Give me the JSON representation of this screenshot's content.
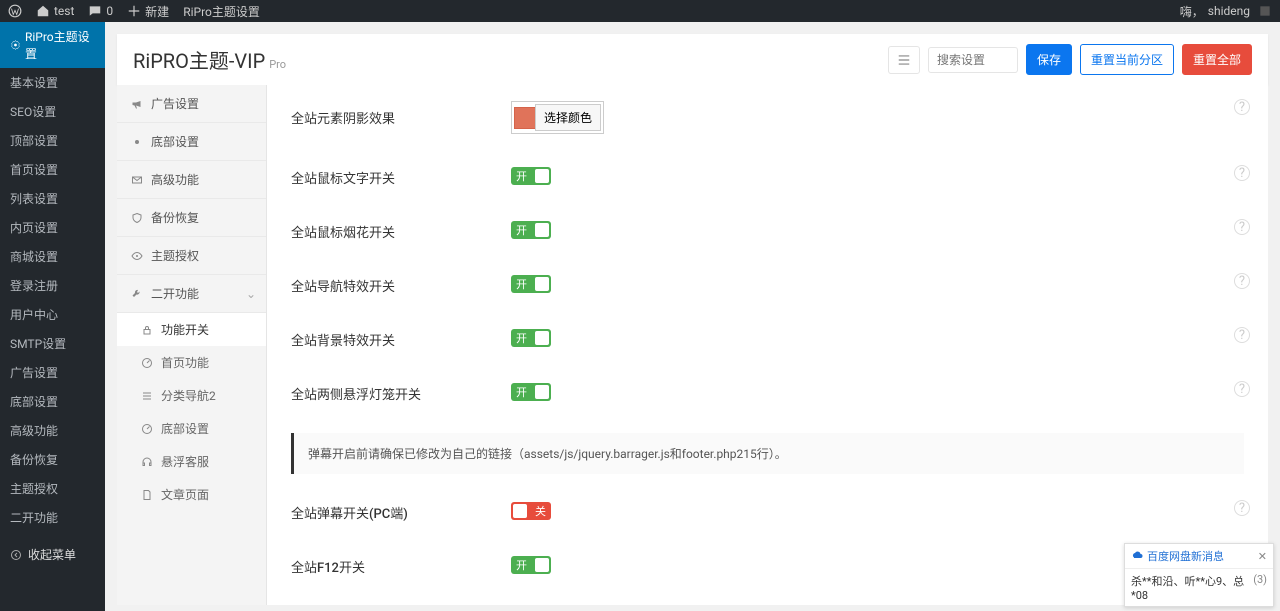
{
  "adminbar": {
    "site_name": "test",
    "comments_count": "0",
    "new_label": "新建",
    "theme_settings": "RiPro主题设置",
    "greeting": "嗨，",
    "user": "shideng"
  },
  "wp_menu": {
    "current": "RiPro主题设置",
    "items": [
      "基本设置",
      "SEO设置",
      "顶部设置",
      "首页设置",
      "列表设置",
      "内页设置",
      "商城设置",
      "登录注册",
      "用户中心",
      "SMTP设置",
      "广告设置",
      "底部设置",
      "高级功能",
      "备份恢复",
      "主题授权",
      "二开功能"
    ],
    "collapse": "收起菜单"
  },
  "header": {
    "title": "RiPRO主题-VIP",
    "badge": "Pro",
    "search_placeholder": "搜索设置",
    "save": "保存",
    "reset_section": "重置当前分区",
    "reset_all": "重置全部"
  },
  "panel_nav": {
    "items": [
      {
        "icon": "bullhorn",
        "label": "广告设置"
      },
      {
        "icon": "dot",
        "label": "底部设置"
      },
      {
        "icon": "envelope",
        "label": "高级功能"
      },
      {
        "icon": "shield",
        "label": "备份恢复"
      },
      {
        "icon": "eye",
        "label": "主题授权"
      },
      {
        "icon": "wrench",
        "label": "二开功能",
        "expanded": true
      }
    ],
    "subs": [
      {
        "icon": "lock",
        "label": "功能开关",
        "active": true
      },
      {
        "icon": "dashboard",
        "label": "首页功能"
      },
      {
        "icon": "list",
        "label": "分类导航2"
      },
      {
        "icon": "dashboard",
        "label": "底部设置"
      },
      {
        "icon": "headset",
        "label": "悬浮客服"
      },
      {
        "icon": "page",
        "label": "文章页面"
      }
    ]
  },
  "settings": [
    {
      "key": "shadow",
      "label": "全站元素阴影效果",
      "type": "color",
      "color": "#e0735a",
      "btn": "选择颜色"
    },
    {
      "key": "mouse_text",
      "label": "全站鼠标文字开关",
      "type": "toggle",
      "on": true,
      "onText": "开"
    },
    {
      "key": "mouse_fire",
      "label": "全站鼠标烟花开关",
      "type": "toggle",
      "on": true,
      "onText": "开"
    },
    {
      "key": "nav_fx",
      "label": "全站导航特效开关",
      "type": "toggle",
      "on": true,
      "onText": "开"
    },
    {
      "key": "bg_fx",
      "label": "全站背景特效开关",
      "type": "toggle",
      "on": true,
      "onText": "开"
    },
    {
      "key": "lantern",
      "label": "全站两侧悬浮灯笼开关",
      "type": "toggle",
      "on": true,
      "onText": "开"
    }
  ],
  "notice": "弹幕开启前请确保已修改为自己的链接（assets/js/jquery.barrager.js和footer.php215行）。",
  "settings2": [
    {
      "key": "barrage",
      "label": "全站弹幕开关(PC端)",
      "type": "toggle",
      "on": false,
      "offText": "关"
    },
    {
      "key": "f12",
      "label": "全站F12开关",
      "type": "toggle",
      "on": true,
      "onText": "开"
    }
  ],
  "notif": {
    "title": "百度网盘新消息",
    "body": "杀**和沿、听**心9、总*08",
    "count": "(3)"
  }
}
